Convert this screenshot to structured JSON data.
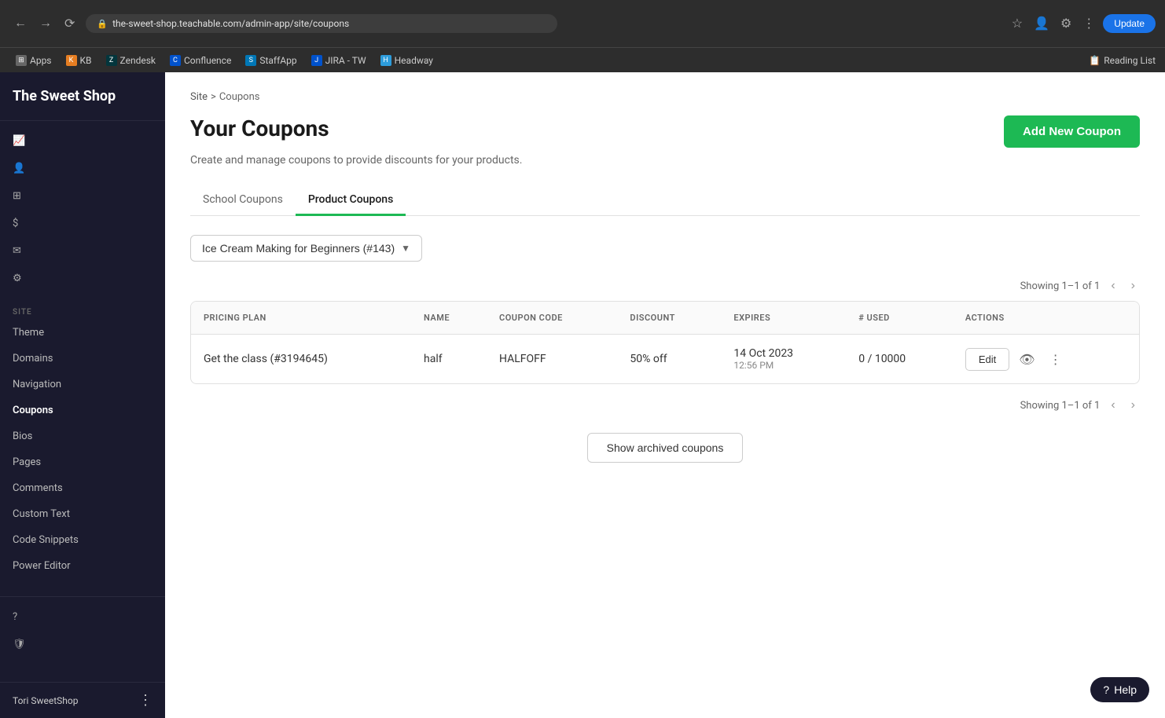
{
  "browser": {
    "url": "the-sweet-shop.teachable.com/admin-app/site/coupons",
    "bookmarks": [
      {
        "id": "apps",
        "label": "Apps",
        "icon": "⊞"
      },
      {
        "id": "kb",
        "label": "KB",
        "icon": "K"
      },
      {
        "id": "zendesk",
        "label": "Zendesk",
        "icon": "Z"
      },
      {
        "id": "confluence",
        "label": "Confluence",
        "icon": "C"
      },
      {
        "id": "staffapp",
        "label": "StaffApp",
        "icon": "S"
      },
      {
        "id": "jira",
        "label": "JIRA - TW",
        "icon": "J"
      },
      {
        "id": "headway",
        "label": "Headway",
        "icon": "H"
      }
    ],
    "update_label": "Update",
    "reading_list_label": "Reading List"
  },
  "sidebar": {
    "brand": "The Sweet Shop",
    "section_label": "SITE",
    "nav_items": [
      {
        "id": "theme",
        "label": "Theme"
      },
      {
        "id": "domains",
        "label": "Domains"
      },
      {
        "id": "navigation",
        "label": "Navigation"
      },
      {
        "id": "coupons",
        "label": "Coupons",
        "active": true
      },
      {
        "id": "bios",
        "label": "Bios"
      },
      {
        "id": "pages",
        "label": "Pages"
      },
      {
        "id": "comments",
        "label": "Comments"
      },
      {
        "id": "custom-text",
        "label": "Custom Text"
      },
      {
        "id": "code-snippets",
        "label": "Code Snippets"
      },
      {
        "id": "power-editor",
        "label": "Power Editor"
      }
    ],
    "user_name": "Tori SweetShop"
  },
  "breadcrumb": {
    "site_label": "Site",
    "separator": ">",
    "current": "Coupons"
  },
  "page": {
    "title": "Your Coupons",
    "subtitle": "Create and manage coupons to provide discounts for your products.",
    "add_button_label": "Add New Coupon"
  },
  "tabs": [
    {
      "id": "school-coupons",
      "label": "School Coupons",
      "active": false
    },
    {
      "id": "product-coupons",
      "label": "Product Coupons",
      "active": true
    }
  ],
  "filter_dropdown": {
    "selected": "Ice Cream Making for Beginners (#143)"
  },
  "pagination": {
    "top_showing": "Showing 1–1 of 1",
    "bottom_showing": "Showing 1–1 of 1"
  },
  "table": {
    "columns": [
      {
        "id": "pricing-plan",
        "label": "PRICING PLAN"
      },
      {
        "id": "name",
        "label": "NAME"
      },
      {
        "id": "coupon-code",
        "label": "COUPON CODE"
      },
      {
        "id": "discount",
        "label": "DISCOUNT"
      },
      {
        "id": "expires",
        "label": "EXPIRES"
      },
      {
        "id": "used",
        "label": "# USED"
      },
      {
        "id": "actions",
        "label": "ACTIONS"
      }
    ],
    "rows": [
      {
        "pricing_plan": "Get the class (#3194645)",
        "name": "half",
        "coupon_code": "HALFOFF",
        "discount": "50% off",
        "expires_date": "14 Oct 2023",
        "expires_time": "12:56 PM",
        "used": "0 / 10000"
      }
    ]
  },
  "actions": {
    "edit_label": "Edit"
  },
  "show_archived_label": "Show archived coupons"
}
